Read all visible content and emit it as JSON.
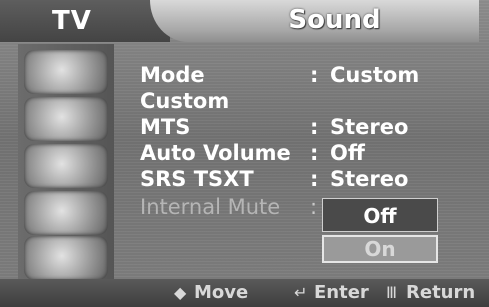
{
  "header": {
    "section_label": "TV",
    "title": "Sound"
  },
  "menu": {
    "rows": [
      {
        "label": "Mode",
        "colon": ":",
        "value": "Custom"
      },
      {
        "label": "Custom"
      },
      {
        "label": "MTS",
        "colon": ":",
        "value": "Stereo"
      },
      {
        "label": "Auto Volume",
        "colon": ":",
        "value": "Off"
      },
      {
        "label": "SRS TSXT",
        "colon": ":",
        "value": "Stereo"
      },
      {
        "label": "Internal Mute",
        "colon": ":"
      }
    ],
    "dropdown_options": [
      "Off",
      "On"
    ]
  },
  "sidebar": {
    "icons": [
      "picture-icon",
      "sound-icon",
      "channel-icon",
      "setup-icon",
      "input-icon"
    ]
  },
  "footer": {
    "move_icon": "◆",
    "move_label": "Move",
    "enter_icon": "↵",
    "enter_label": "Enter",
    "return_icon": "Ⅲ",
    "return_label": "Return"
  }
}
